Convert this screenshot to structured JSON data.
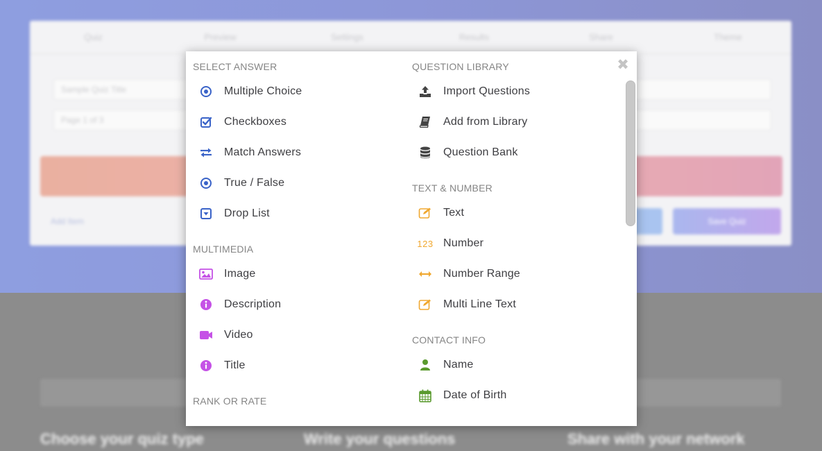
{
  "background": {
    "tabs": [
      "Quiz",
      "Preview",
      "Settings",
      "Results",
      "Share",
      "Theme"
    ],
    "fields": [
      {
        "value": "Sample Quiz Title"
      },
      {
        "value": "Page 1 of 3"
      }
    ],
    "link": "Add Item",
    "button_primary": "Save Quiz",
    "captions": [
      "Choose your quiz type",
      "Write your questions",
      "Share with your network"
    ]
  },
  "modal": {
    "close_label": "✖",
    "sections": {
      "select_answer": {
        "title": "SELECT ANSWER",
        "items": [
          {
            "label": "Multiple Choice",
            "icon": "radio-dot-icon"
          },
          {
            "label": "Checkboxes",
            "icon": "checkbox-icon"
          },
          {
            "label": "Match Answers",
            "icon": "exchange-arrows-icon"
          },
          {
            "label": "True / False",
            "icon": "radio-dot-icon"
          },
          {
            "label": "Drop List",
            "icon": "dropdown-box-icon"
          }
        ]
      },
      "multimedia": {
        "title": "MULTIMEDIA",
        "items": [
          {
            "label": "Image",
            "icon": "image-icon"
          },
          {
            "label": "Description",
            "icon": "info-circle-icon"
          },
          {
            "label": "Video",
            "icon": "video-camera-icon"
          },
          {
            "label": "Title",
            "icon": "info-circle-icon"
          }
        ]
      },
      "rank_or_rate": {
        "title": "RANK OR RATE"
      },
      "question_library": {
        "title": "QUESTION LIBRARY",
        "items": [
          {
            "label": "Import Questions",
            "icon": "upload-icon"
          },
          {
            "label": "Add from Library",
            "icon": "book-icon"
          },
          {
            "label": "Question Bank",
            "icon": "database-icon"
          }
        ]
      },
      "text_number": {
        "title": "TEXT & NUMBER",
        "items": [
          {
            "label": "Text",
            "icon": "edit-icon"
          },
          {
            "label": "Number",
            "icon": "number-123-icon",
            "glyph": "123"
          },
          {
            "label": "Number Range",
            "icon": "horizontal-arrows-icon"
          },
          {
            "label": "Multi Line Text",
            "icon": "edit-icon"
          }
        ]
      },
      "contact_info": {
        "title": "CONTACT INFO",
        "items": [
          {
            "label": "Name",
            "icon": "user-icon"
          },
          {
            "label": "Date of Birth",
            "icon": "calendar-icon"
          }
        ]
      }
    }
  },
  "colors": {
    "blue": "#3a63c8",
    "purple": "#c552e6",
    "orange": "#f0a830",
    "green": "#5a9a2e",
    "dark": "#444444"
  }
}
